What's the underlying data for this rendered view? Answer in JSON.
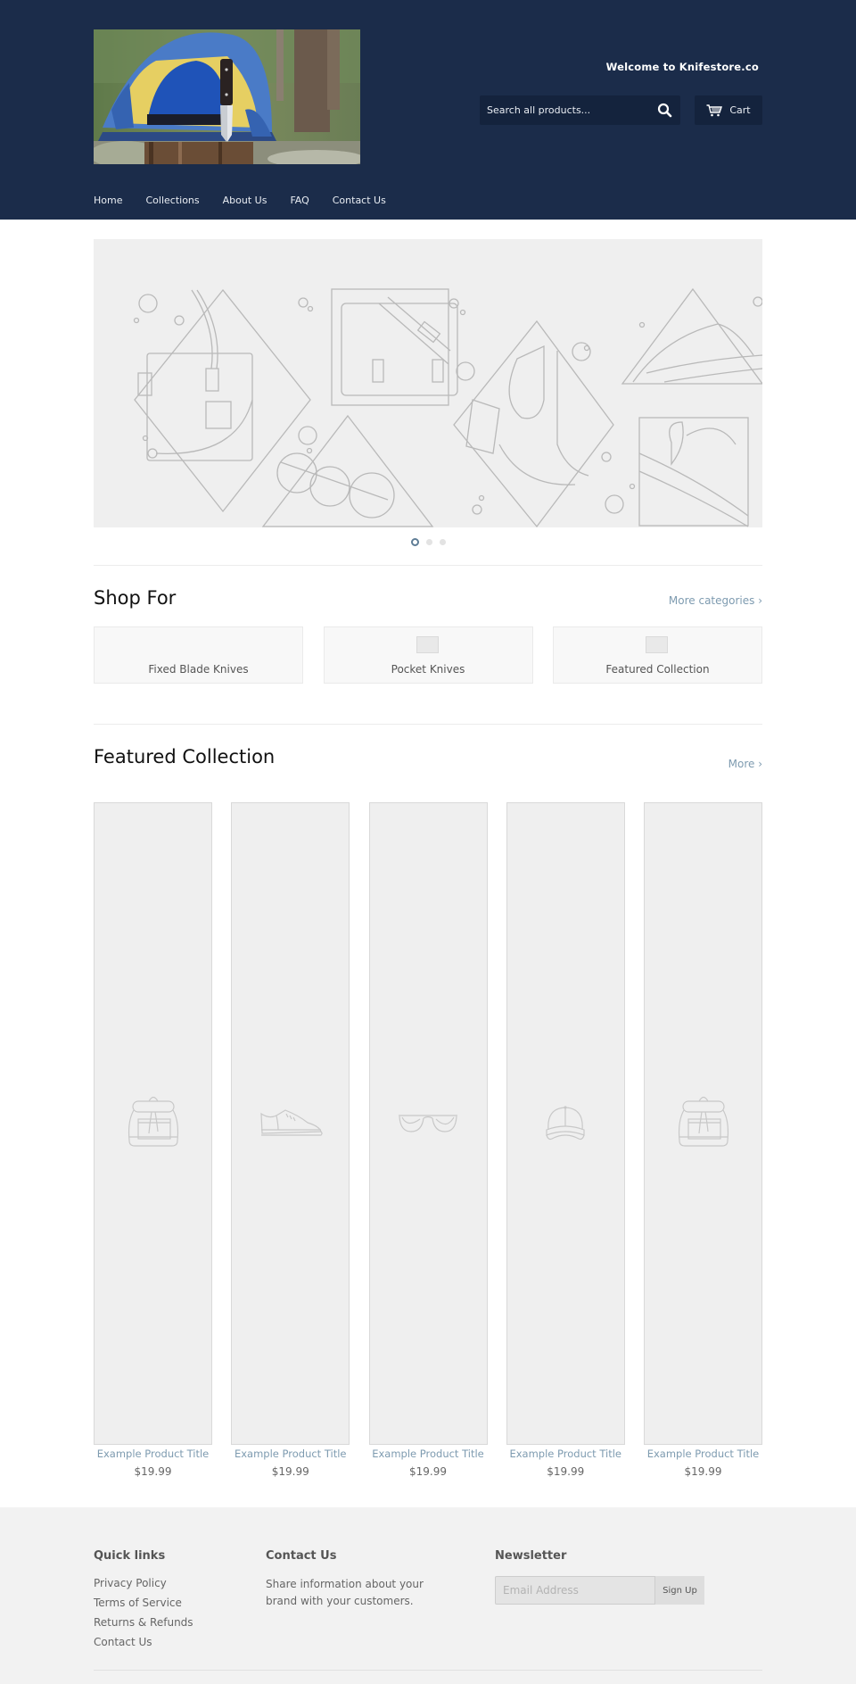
{
  "header": {
    "logo_alt": "Knifestore.co logo - knife in stump in front of tent",
    "welcome": "Welcome to Knifestore.co",
    "search": {
      "placeholder": "Search all products...",
      "icon": "search-icon"
    },
    "cart": {
      "label": "Cart",
      "icon": "cart-icon"
    },
    "nav": [
      {
        "label": "Home"
      },
      {
        "label": "Collections"
      },
      {
        "label": "About Us"
      },
      {
        "label": "FAQ"
      },
      {
        "label": "Contact Us"
      }
    ]
  },
  "slideshow": {
    "slide_count": 3,
    "active_slide": 1
  },
  "shop_for": {
    "title": "Shop For",
    "more_link": "More categories ›",
    "categories": [
      {
        "label": "Fixed Blade Knives",
        "has_thumb": false
      },
      {
        "label": "Pocket Knives",
        "has_thumb": true
      },
      {
        "label": "Featured Collection",
        "has_thumb": true
      }
    ]
  },
  "featured": {
    "title": "Featured Collection",
    "more_link": "More ›",
    "products": [
      {
        "title": "Example Product Title",
        "price": "$19.99",
        "placeholder_icon": "backpack-icon"
      },
      {
        "title": "Example Product Title",
        "price": "$19.99",
        "placeholder_icon": "sneaker-icon"
      },
      {
        "title": "Example Product Title",
        "price": "$19.99",
        "placeholder_icon": "sunglasses-icon"
      },
      {
        "title": "Example Product Title",
        "price": "$19.99",
        "placeholder_icon": "cap-icon"
      },
      {
        "title": "Example Product Title",
        "price": "$19.99",
        "placeholder_icon": "backpack-icon"
      }
    ]
  },
  "footer": {
    "quick_links": {
      "title": "Quick links",
      "links": [
        "Privacy Policy",
        "Terms of Service",
        "Returns & Refunds",
        "Contact Us"
      ]
    },
    "contact": {
      "title": "Contact Us",
      "text": "Share information about your brand with your customers."
    },
    "newsletter": {
      "title": "Newsletter",
      "placeholder": "Email Address",
      "button": "Sign Up"
    }
  },
  "colors": {
    "header_bg": "#1b2c4a",
    "header_control_bg": "#14233d",
    "link_accent": "#7e9bb0",
    "placeholder_bg": "#efefef",
    "footer_bg": "#f2f2f2"
  }
}
